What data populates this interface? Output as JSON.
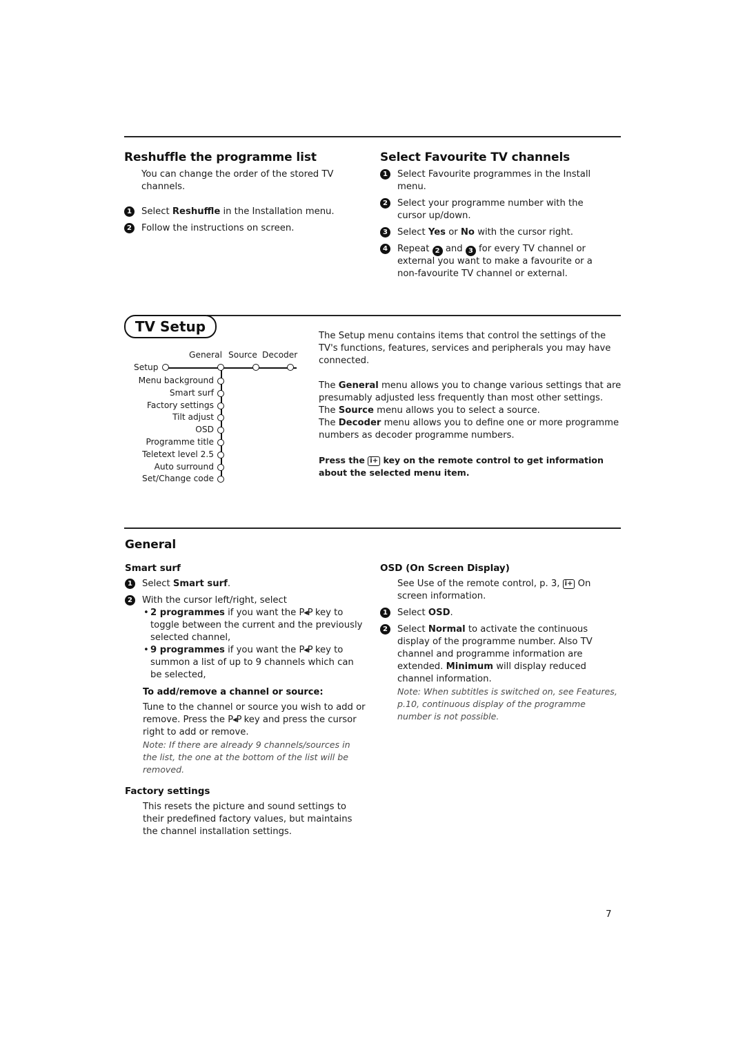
{
  "reshuffle": {
    "title": "Reshuffle the programme list",
    "intro": "You can change the order of the stored TV channels.",
    "steps": [
      {
        "num": "1",
        "pre": "Select ",
        "bold": "Reshuffle",
        "post": " in the Installation menu."
      },
      {
        "num": "2",
        "text": "Follow the instructions on screen."
      }
    ]
  },
  "favourite": {
    "title": "Select Favourite TV channels",
    "steps": [
      {
        "num": "1",
        "text": "Select Favourite programmes in the Install menu."
      },
      {
        "num": "2",
        "text": "Select your programme number with the cursor up/down."
      },
      {
        "num": "3",
        "pre": "Select ",
        "bold1": "Yes",
        "mid": " or ",
        "bold2": "No",
        "post": " with the cursor right."
      },
      {
        "num": "4",
        "pre": "Repeat ",
        "ref1": "2",
        "mid": " and ",
        "ref2": "3",
        "post": " for every TV channel or external you want to make a favourite or a non-favourite TV channel or external."
      }
    ]
  },
  "tv_setup": {
    "title": "TV Setup",
    "menu": {
      "root": "Setup",
      "columns": [
        "General",
        "Source",
        "Decoder"
      ],
      "general_items": [
        "Menu background",
        "Smart surf",
        "Factory settings",
        "Tilt adjust",
        "OSD",
        "Programme title",
        "Teletext level 2.5",
        "Auto surround",
        "Set/Change code"
      ]
    },
    "para1": "The Setup menu contains items that control the settings of the TV's functions, features, services and peripherals you may have connected.",
    "para2": {
      "pre": "The ",
      "bold": "General",
      "post": " menu allows you to change various settings that are presumably adjusted less frequently than most other settings."
    },
    "para3": {
      "pre": "The ",
      "bold": "Source",
      "post": " menu allows you to select a source."
    },
    "para4": {
      "pre": "The ",
      "bold": "Decoder",
      "post": " menu allows you to define one or more programme numbers as decoder programme numbers."
    },
    "info": {
      "pre": "Press the ",
      "key": "i+",
      "post": " key on the remote control to get information about the selected menu item."
    }
  },
  "general": {
    "title": "General",
    "smart_surf": {
      "title": "Smart surf",
      "step1": {
        "num": "1",
        "pre": "Select ",
        "bold": "Smart surf",
        "post": "."
      },
      "step2": {
        "num": "2",
        "text": "With the cursor left/right, select"
      },
      "bullets": [
        {
          "bold": "2 programmes",
          "pre": " if you want the ",
          "key": "P◂P",
          "post": " key to toggle between the current and the previously selected channel,"
        },
        {
          "bold": "9 programmes",
          "pre": " if you want the ",
          "key": "P◂P",
          "post": " key to summon a list of up to 9 channels which can be selected,"
        }
      ],
      "add_remove_title": "To add/remove a channel or source:",
      "add_remove": {
        "pre": "Tune to the channel or source you wish to add or remove. Press the ",
        "key": "P◂P",
        "post": " key and press the cursor right to add or remove."
      },
      "note": "Note: If there are already 9 channels/sources in the list, the one at the bottom of the list will be removed."
    },
    "factory": {
      "title": "Factory settings",
      "text": "This resets the picture and sound settings to their predefined factory values, but maintains the channel installation settings."
    },
    "osd": {
      "title": "OSD (On Screen Display)",
      "intro": {
        "pre": "See Use of the remote control, p. 3, ",
        "key": "i+",
        "post": " On screen information."
      },
      "step1": {
        "num": "1",
        "pre": "Select ",
        "bold": "OSD",
        "post": "."
      },
      "step2": {
        "num": "2",
        "pre": "Select ",
        "bold1": "Normal",
        "mid": " to activate the continuous display of the programme number. Also TV channel and programme information are extended. ",
        "bold2": "Minimum",
        "post": " will display reduced channel information."
      },
      "note": "Note: When subtitles is switched on, see Features, p.10, continuous display of the programme number is not possible."
    }
  },
  "page_number": "7"
}
